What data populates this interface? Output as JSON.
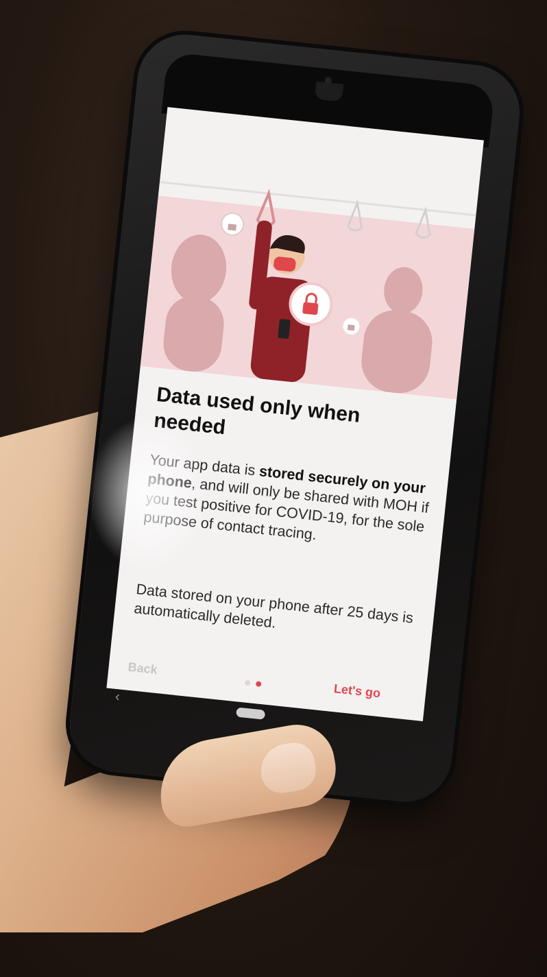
{
  "screen": {
    "title": "Data used only when needed",
    "paragraph1": {
      "pre": "Your app data is ",
      "bold": "stored securely on your phone",
      "post": ", and will only be shared with MOH if you test positive for COVID-19, for the sole purpose of contact tracing."
    },
    "paragraph2": "Data stored on your phone after 25 days is automatically deleted.",
    "back_label": "Back",
    "next_label": "Let's go",
    "pagination": {
      "total": 2,
      "current": 2
    }
  },
  "colors": {
    "accent": "#e0474c",
    "illustration_bg": "#f3d6d8",
    "shirt": "#8e2228"
  }
}
